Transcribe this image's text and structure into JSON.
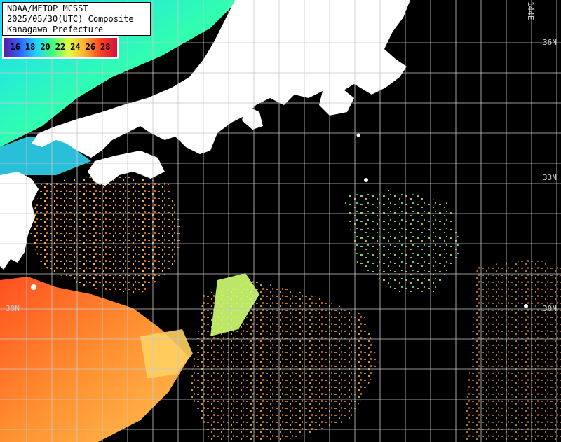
{
  "title": {
    "line1": "NOAA/METOP MCSST",
    "line2": "2025/05/30(UTC) Composite",
    "line3": "Kanagawa Prefecture"
  },
  "legend": {
    "ticks": [
      "16",
      "18",
      "20",
      "22",
      "24",
      "26",
      "28"
    ],
    "colors": [
      "#5a1aa0",
      "#3060ff",
      "#20d0ff",
      "#40ff80",
      "#e0ff40",
      "#ffb030",
      "#ff4020",
      "#d01040"
    ]
  },
  "grid_labels": {
    "lon": "144E",
    "lat_36": "36N",
    "lat_33": "33N",
    "lat_30_left": "30N",
    "lat_30_right": "30N"
  },
  "colors": {
    "land": "#ffffff",
    "cloud": "#000000",
    "grid": "#c8c8c8"
  }
}
